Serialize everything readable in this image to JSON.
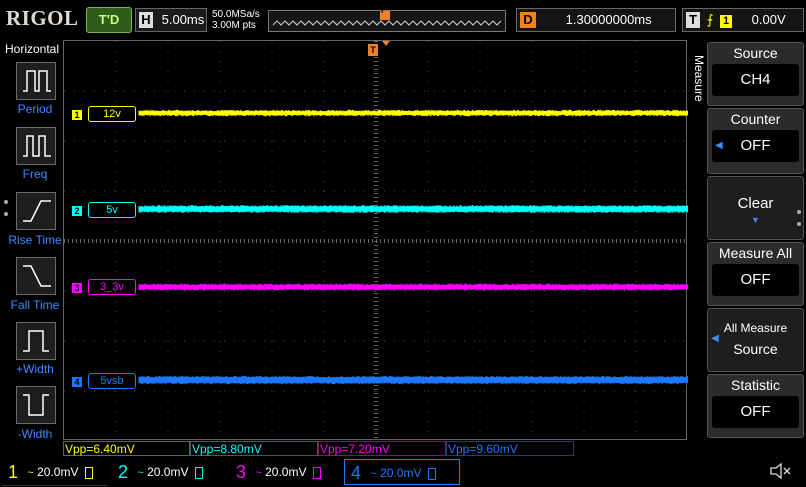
{
  "top_bar": {
    "logo": "RIGOL",
    "run_status": "T'D",
    "timebase_label": "H",
    "timebase_value": "5.00ms",
    "sample_rate": "50.0MSa/s",
    "memory_depth": "3.00M pts",
    "trigger_marker": "T",
    "delay_label": "D",
    "delay_value": "1.30000000ms",
    "trigger_label": "T",
    "trigger_source": "1",
    "trigger_level": "0.00V"
  },
  "left_panel": {
    "title": "Horizontal",
    "items": [
      {
        "label": "Period"
      },
      {
        "label": "Freq"
      },
      {
        "label": "Rise Time"
      },
      {
        "label": "Fall Time"
      },
      {
        "label": "+Width"
      },
      {
        "label": "-Width"
      }
    ]
  },
  "channels": [
    {
      "number": "1",
      "tag": "12v",
      "color": "#ffff00",
      "scale": "20.0mV",
      "vpp": "Vpp=6.40mV"
    },
    {
      "number": "2",
      "tag": "5v",
      "color": "#00ffff",
      "scale": "20.0mV",
      "vpp": "Vpp=8.80mV"
    },
    {
      "number": "3",
      "tag": "3_3v",
      "color": "#ff00ff",
      "scale": "20.0mV",
      "vpp": "Vpp=7.20mV"
    },
    {
      "number": "4",
      "tag": "5vsb",
      "color": "#1e78ff",
      "scale": "20.0mV",
      "vpp": "Vpp=9.60mV"
    }
  ],
  "right_panel": {
    "menu_title": "Measure",
    "source": {
      "title": "Source",
      "value": "CH4"
    },
    "counter": {
      "title": "Counter",
      "value": "OFF"
    },
    "clear": {
      "title": "Clear"
    },
    "measure_all": {
      "title": "Measure All",
      "value": "OFF"
    },
    "all_measure_source": {
      "line1": "All Measure",
      "line2": "Source"
    },
    "statistic": {
      "title": "Statistic",
      "value": "OFF"
    }
  },
  "colors": {
    "accent_blue": "#3a8cff",
    "delay_orange": "#f08020",
    "grid": "#4a4a4a"
  }
}
